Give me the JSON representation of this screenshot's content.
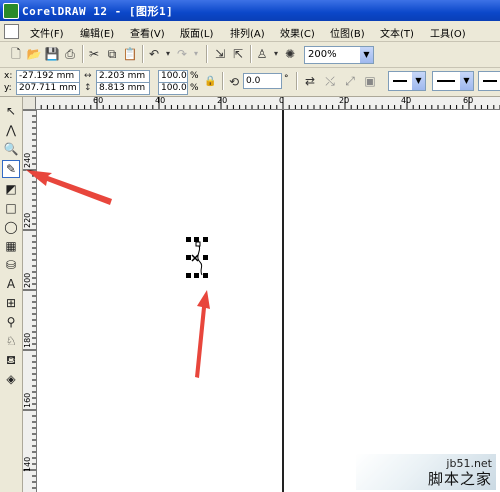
{
  "window": {
    "title": "CorelDRAW 12 - [图形1]"
  },
  "menu": {
    "items": [
      "文件(F)",
      "编辑(E)",
      "查看(V)",
      "版面(L)",
      "排列(A)",
      "效果(C)",
      "位图(B)",
      "文本(T)",
      "工具(O)"
    ]
  },
  "toolbar": {
    "zoom_value": "200%"
  },
  "propertybar": {
    "x_label": "x:",
    "y_label": "y:",
    "x_value": "-27.192 mm",
    "y_value": "207.711 mm",
    "width_value": "2.203 mm",
    "height_value": "8.813 mm",
    "scale_x": "100.0",
    "scale_y": "100.0",
    "percent": "%",
    "rotation": "0.0",
    "degree": "°"
  },
  "ruler_top": {
    "labels": [
      "60",
      "40",
      "20",
      "0",
      "20",
      "40",
      "60"
    ]
  },
  "ruler_left": {
    "labels": [
      "240",
      "220",
      "200",
      "180",
      "160",
      "140"
    ]
  },
  "watermark": {
    "site": "jb51.net",
    "brand": "脚本之家"
  },
  "colors": {
    "titlebar": "#0b47c9",
    "chrome": "#ece9d8",
    "arrow": "#e8463c"
  }
}
